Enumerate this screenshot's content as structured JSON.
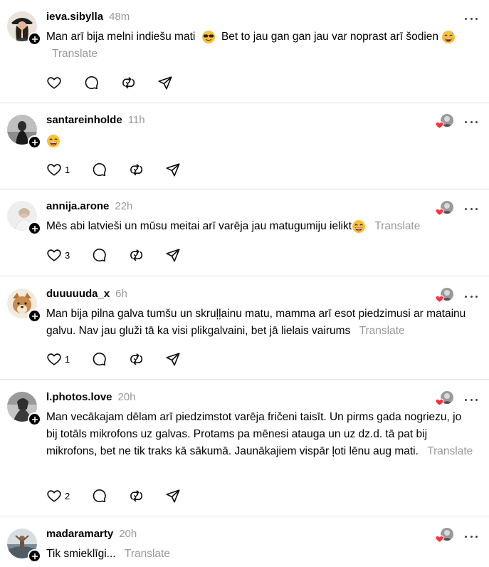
{
  "icons": {
    "like": "heart-outline-icon",
    "reply": "speech-bubble-icon",
    "repost": "repost-icon",
    "share": "paper-plane-icon",
    "more": "more-dots-icon",
    "follow": "plus-icon",
    "liked": "heart-filled-icon"
  },
  "colors": {
    "text": "#000000",
    "muted": "#999999",
    "divider": "#e0e0e0",
    "liked_heart": "#ff3040"
  },
  "posts": [
    {
      "username": "ieva.sibylla",
      "time": "48m",
      "text_a": "Man arī bija melni indiešu mati",
      "text_b": "Bet to jau gan gan jau var noprast arī šodien",
      "translate": "Translate",
      "likes": "",
      "liked_by": false
    },
    {
      "username": "santareinholde",
      "time": "11h",
      "text": "",
      "translate": "",
      "likes": "1",
      "liked_by": true
    },
    {
      "username": "annija.arone",
      "time": "22h",
      "text": "Mēs abi latvieši un mūsu meitai arī varēja jau matugumiju ielikt",
      "translate": "Translate",
      "likes": "3",
      "liked_by": true
    },
    {
      "username": "duuuuuda_x",
      "time": "6h",
      "text": "Man bija pilna galva tumšu un skruļļainu matu, mamma arī esot piedzimusi ar matainu galvu. Nav jau gluži tā ka visi plikgalvaini, bet jā lielais vairums",
      "translate": "Translate",
      "likes": "1",
      "liked_by": true
    },
    {
      "username": "l.photos.love",
      "time": "20h",
      "text": "Man vecākajam dēlam arī piedzimstot varēja fričeni taisīt. Un pirms gada nogriezu, jo bij totāls mikrofons uz galvas. Protams pa mēnesi atauga un uz dz.d. tā pat bij mikrofons, bet ne tik traks kā sākumā. Jaunākajiem vispār ļoti lēnu aug mati.",
      "translate": "Translate",
      "likes": "2",
      "liked_by": true
    },
    {
      "username": "madaramarty",
      "time": "20h",
      "text": "Tik smieklīgi...",
      "translate": "Translate",
      "likes": "",
      "liked_by": true
    }
  ]
}
